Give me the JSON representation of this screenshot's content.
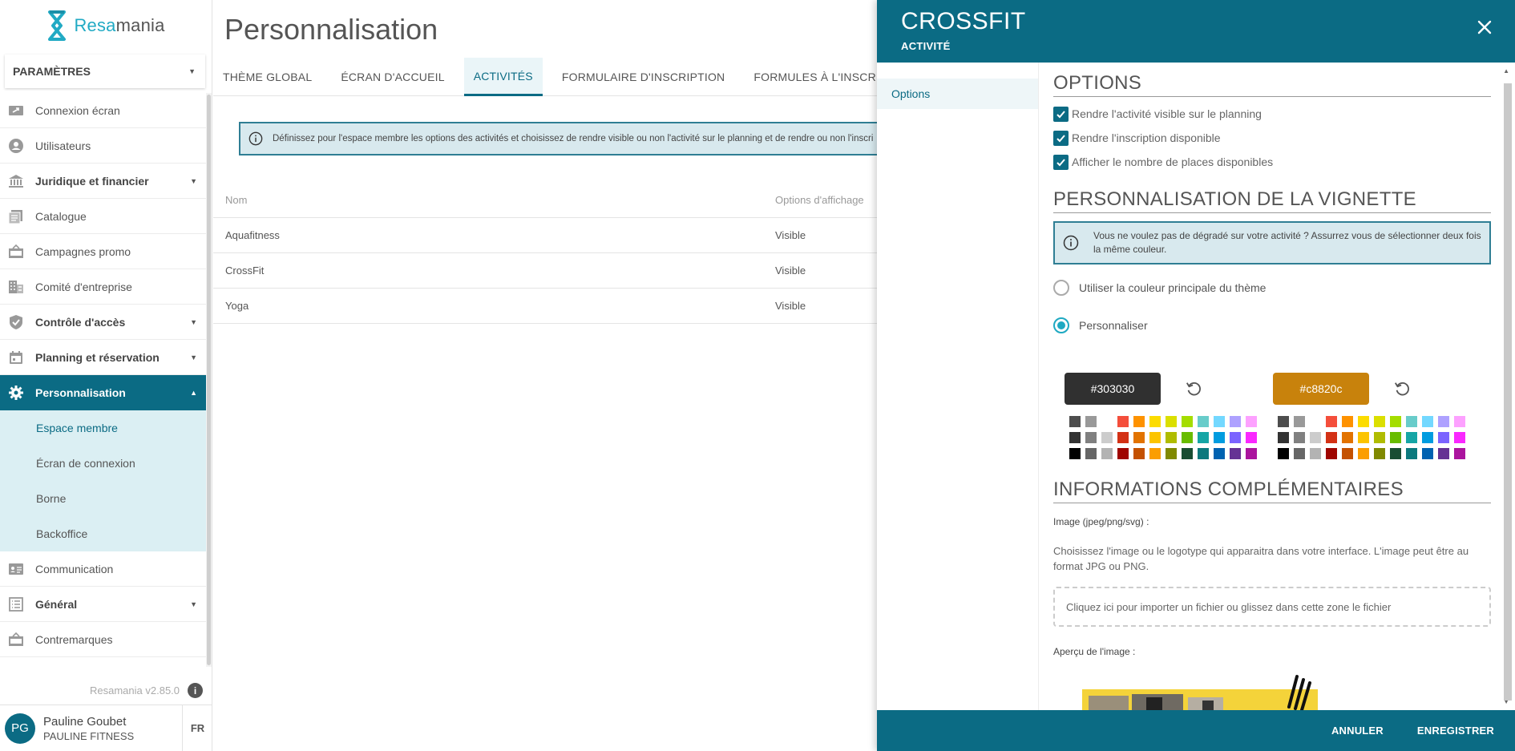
{
  "app": {
    "logo_prefix": "Resa",
    "logo_suffix": "mania",
    "version": "Resamania v2.85.0"
  },
  "sidebar": {
    "section_select": "PARAMÈTRES",
    "items": [
      {
        "label": "Connexion écran",
        "icon": "screen-login-icon",
        "bold": false,
        "caret": false
      },
      {
        "label": "Utilisateurs",
        "icon": "user-icon",
        "bold": false,
        "caret": false
      },
      {
        "label": "Juridique et financier",
        "icon": "bank-icon",
        "bold": true,
        "caret": true
      },
      {
        "label": "Catalogue",
        "icon": "catalog-icon",
        "bold": false,
        "caret": false
      },
      {
        "label": "Campagnes promo",
        "icon": "promo-icon",
        "bold": false,
        "caret": false
      },
      {
        "label": "Comité d'entreprise",
        "icon": "building-icon",
        "bold": false,
        "caret": false
      },
      {
        "label": "Contrôle d'accès",
        "icon": "shield-icon",
        "bold": true,
        "caret": true
      },
      {
        "label": "Planning et réservation",
        "icon": "calendar-icon",
        "bold": true,
        "caret": true
      },
      {
        "label": "Personnalisation",
        "icon": "gear-icon",
        "bold": true,
        "caret": true,
        "active": true
      }
    ],
    "sub_items": [
      "Espace membre",
      "Écran de connexion",
      "Borne",
      "Backoffice"
    ],
    "items_after": [
      {
        "label": "Communication",
        "icon": "contact-card-icon",
        "bold": false,
        "caret": false
      },
      {
        "label": "Général",
        "icon": "list-icon",
        "bold": true,
        "caret": true
      },
      {
        "label": "Contremarques",
        "icon": "ticket-icon",
        "bold": false,
        "caret": false
      }
    ],
    "user": {
      "initials": "PG",
      "name": "Pauline Goubet",
      "company": "PAULINE FITNESS",
      "lang": "FR"
    }
  },
  "main": {
    "title": "Personnalisation",
    "tabs": [
      "THÈME GLOBAL",
      "ÉCRAN D'ACCUEIL",
      "ACTIVITÉS",
      "FORMULAIRE D'INSCRIPTION",
      "FORMULES À L'INSCRIPTION"
    ],
    "active_tab": 2,
    "notice": "Définissez pour l'espace membre les options des activités et choisissez de rendre visible ou non l'activité sur le planning et de rendre ou non l'inscri",
    "table": {
      "headers": [
        "Nom",
        "Options d'affichage"
      ],
      "rows": [
        [
          "Aquafitness",
          "Visible"
        ],
        [
          "CrossFit",
          "Visible"
        ],
        [
          "Yoga",
          "Visible"
        ]
      ]
    }
  },
  "drawer": {
    "title": "CROSSFIT",
    "subtitle": "ACTIVITÉ",
    "nav_item": "Options",
    "options_title": "OPTIONS",
    "checkboxes": [
      "Rendre l'activité visible sur le planning",
      "Rendre l'inscription disponible",
      "Afficher le nombre de places disponibles"
    ],
    "vignette_title": "PERSONNALISATION DE LA VIGNETTE",
    "vignette_notice": "Vous ne voulez pas de dégradé sur votre activité ? Assurrez vous de sélectionner deux fois la même couleur.",
    "radio_theme": "Utiliser la couleur principale du thème",
    "radio_custom": "Personnaliser",
    "color1": "#303030",
    "color2": "#c8820c",
    "info_title": "INFORMATIONS COMPLÉMENTAIRES",
    "image_label": "Image (jpeg/png/svg) :",
    "image_help": "Choisissez l'image ou le logotype qui apparaitra dans votre interface. L'image peut être au format JPG ou PNG.",
    "dropzone": "Cliquez ici pour importer un fichier ou glissez dans cette zone le fichier",
    "preview_label": "Aperçu de l'image :",
    "cancel": "ANNULER",
    "save": "ENREGISTRER"
  },
  "colors": {
    "primary": "#0b6b84",
    "accent": "#1fa9c2",
    "notice_bg": "#d8e9ee"
  },
  "palette": [
    "#4d4d4d",
    "#999999",
    "#ffffff",
    "#f44e3b",
    "#fe9200",
    "#fcdc00",
    "#dbdf00",
    "#a4dd00",
    "#68ccca",
    "#73d8ff",
    "#aea1ff",
    "#fda1ff",
    "#333333",
    "#808080",
    "#cccccc",
    "#d33115",
    "#e27300",
    "#fcc400",
    "#b0bc00",
    "#68bc00",
    "#16a5a5",
    "#009ce0",
    "#7b64ff",
    "#fa28ff",
    "#000000",
    "#666666",
    "#b3b3b3",
    "#9f0500",
    "#c45100",
    "#fb9e00",
    "#808900",
    "#194d33",
    "#0c797d",
    "#0062b1",
    "#653294",
    "#ab149e"
  ]
}
